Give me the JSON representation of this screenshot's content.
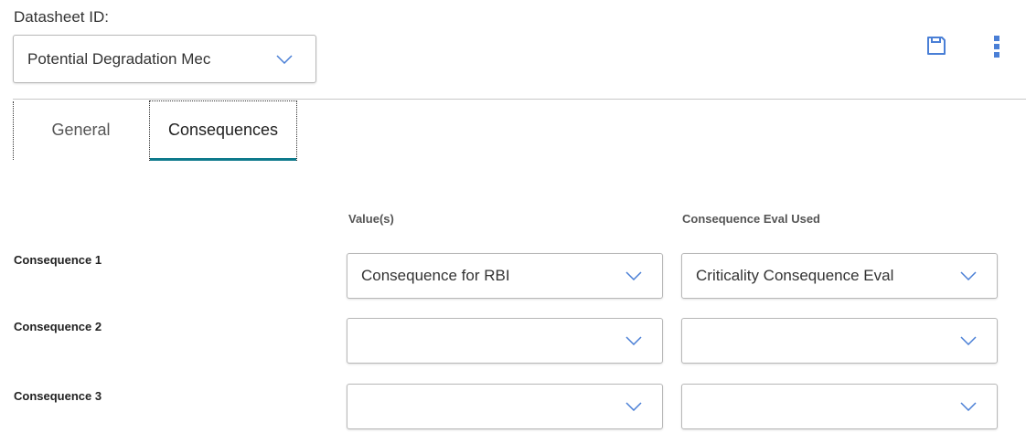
{
  "datasheet": {
    "label": "Datasheet ID:",
    "selected": "Potential Degradation Mec"
  },
  "toolbar": {
    "save_icon": "save-icon",
    "more_icon": "more-vertical-icon",
    "accent_color": "#4a7fd6"
  },
  "tabs": [
    {
      "label": "General",
      "active": false
    },
    {
      "label": "Consequences",
      "active": true
    }
  ],
  "tab_active_color": "#0e7a8c",
  "table": {
    "columns": [
      "Value(s)",
      "Consequence Eval Used"
    ],
    "rows": [
      {
        "label": "Consequence 1",
        "value": "Consequence for RBI",
        "eval": "Criticality Consequence Eval"
      },
      {
        "label": "Consequence 2",
        "value": "",
        "eval": ""
      },
      {
        "label": "Consequence 3",
        "value": "",
        "eval": ""
      }
    ]
  }
}
